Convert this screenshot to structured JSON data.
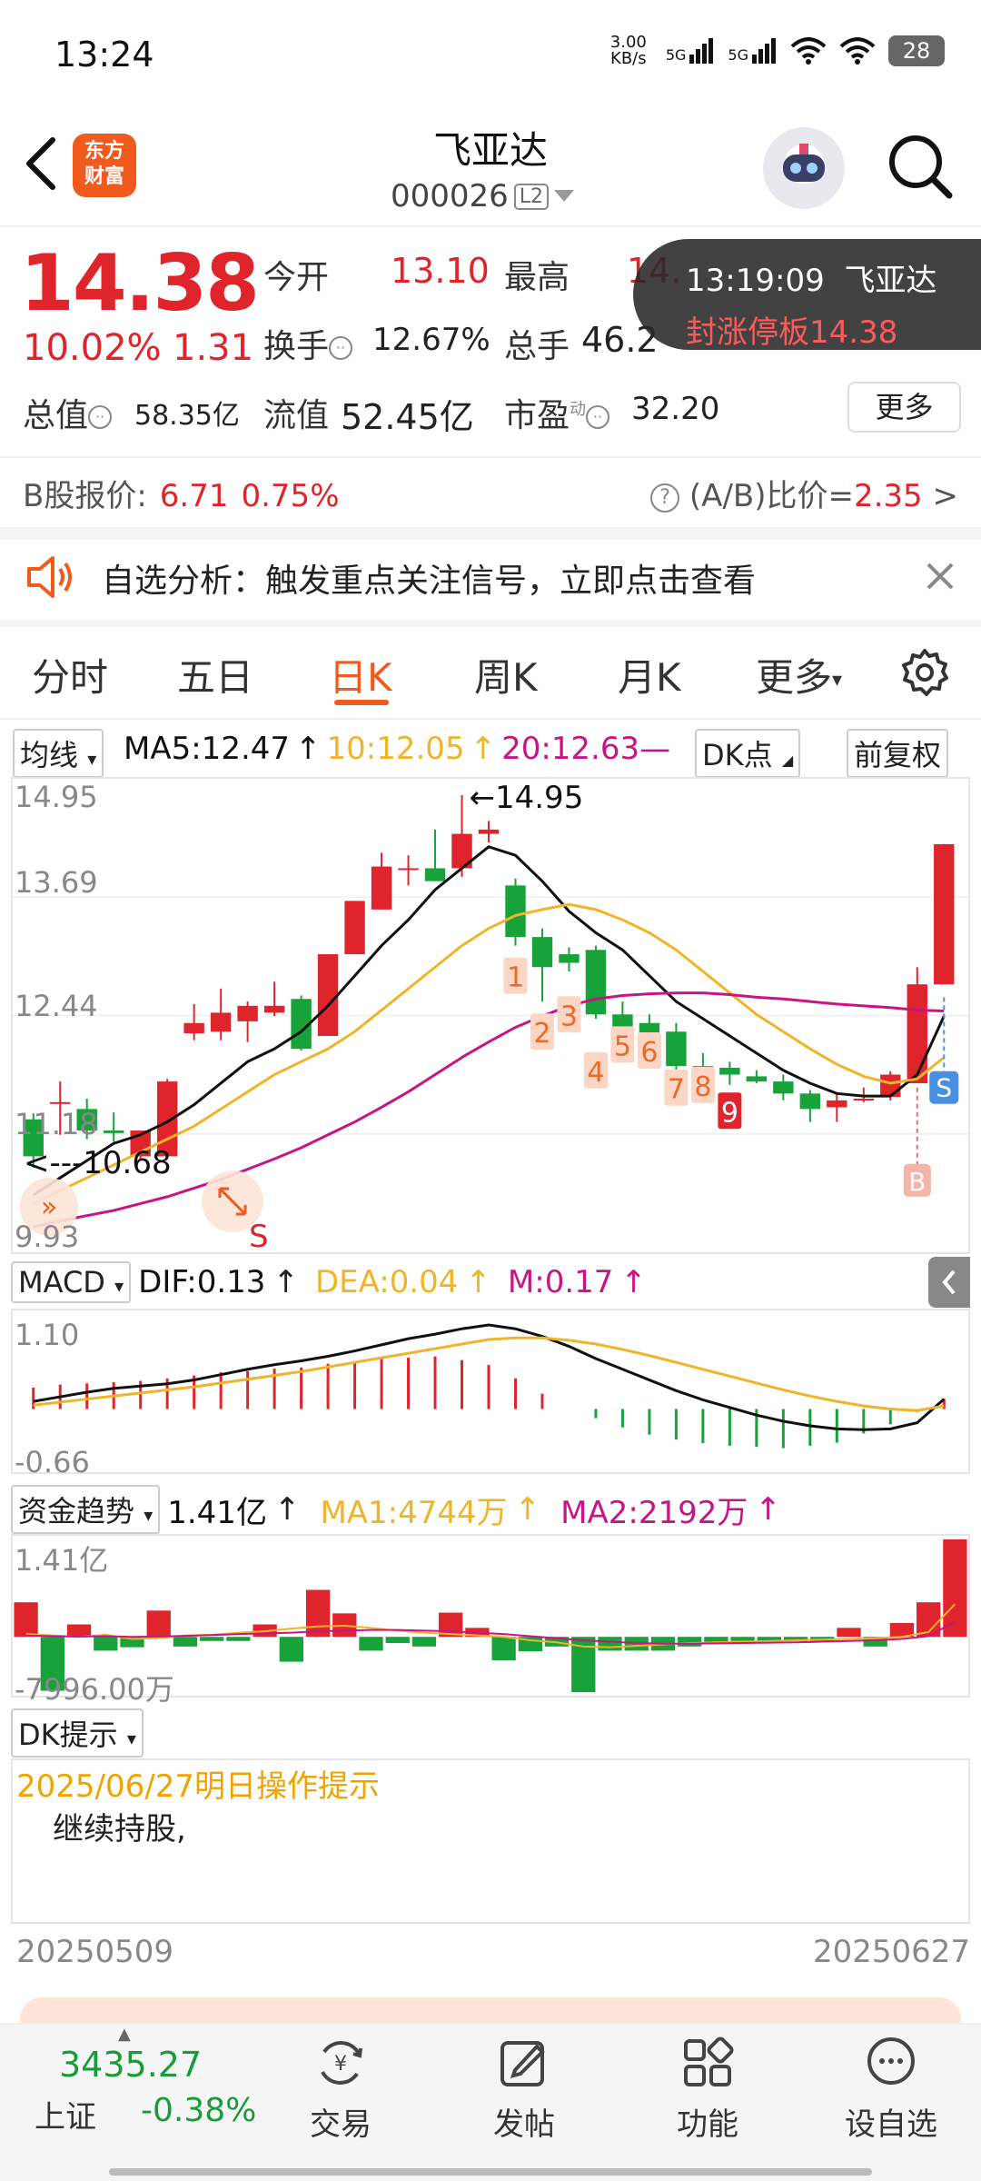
{
  "status_bar": {
    "time": "13:24",
    "net_speed": "3.00 KB/s",
    "signal1": "5G",
    "signal2": "5G",
    "battery": "28"
  },
  "header": {
    "logo_text": "东方财富",
    "stock_name": "飞亚达",
    "stock_code": "000026",
    "level_badge": "L2"
  },
  "quote": {
    "price": "14.38",
    "change_pct": "10.02%",
    "change": "1.31",
    "open_label": "今开",
    "open": "13.10",
    "high_label": "最高",
    "high": "14.",
    "turnover_label": "换手",
    "turnover": "12.67%",
    "volume_label": "总手",
    "volume": "46.2",
    "market_cap_label": "总值",
    "market_cap": "58.35亿",
    "float_cap_label": "流值",
    "float_cap": "52.45亿",
    "pe_label": "市盈",
    "pe_sup": "动",
    "pe": "32.20",
    "more_button": "更多",
    "b_share_label": "B股报价:",
    "b_share_price": "6.71",
    "b_share_pct": "0.75%",
    "ab_ratio_label": "(A/B)比价=",
    "ab_ratio": "2.35"
  },
  "toast": {
    "time": "13:19:09",
    "name": "飞亚达",
    "message": "封涨停板14.38"
  },
  "notice": {
    "text": "自选分析：触发重点关注信号，立即点击查看"
  },
  "tabs": [
    {
      "label": "分时",
      "active": false
    },
    {
      "label": "五日",
      "active": false
    },
    {
      "label": "日K",
      "active": true
    },
    {
      "label": "周K",
      "active": false
    },
    {
      "label": "月K",
      "active": false
    },
    {
      "label": "更多",
      "active": false
    }
  ],
  "kline_header": {
    "indicator_select": "均线",
    "ma5": "MA5:12.47",
    "ma10": "10:12.05",
    "ma20": "20:12.63—",
    "dk_select": "DK点",
    "adjust": "前复权"
  },
  "colors": {
    "up": "#e0242b",
    "down": "#17a23a",
    "ma5": "#111111",
    "ma10": "#f0b429",
    "ma20": "#c71585",
    "accent": "#f05a1c"
  },
  "chart_data": [
    {
      "type": "candlestick",
      "title": "",
      "ylim": [
        9.93,
        14.95
      ],
      "y_ticks": [
        "14.95",
        "13.69",
        "12.44",
        "11.18",
        "9.93"
      ],
      "annotations": {
        "high_marker": "14.95",
        "low_marker": "10.68",
        "sell_mark": "S",
        "buy_mark": "B",
        "signal_mark": "S"
      },
      "seq_labels": [
        "1",
        "2",
        "3",
        "4",
        "5",
        "6",
        "7",
        "8",
        "9"
      ],
      "ohlc": [
        [
          11.18,
          11.25,
          10.62,
          10.75
        ],
        [
          11.38,
          11.62,
          11.0,
          11.38
        ],
        [
          11.3,
          11.42,
          10.95,
          11.05
        ],
        [
          11.05,
          11.26,
          10.92,
          11.02
        ],
        [
          10.75,
          11.05,
          10.7,
          11.05
        ],
        [
          10.75,
          11.65,
          10.75,
          11.62
        ],
        [
          12.18,
          12.52,
          12.1,
          12.3
        ],
        [
          12.2,
          12.7,
          12.1,
          12.42
        ],
        [
          12.32,
          12.55,
          12.08,
          12.5
        ],
        [
          12.42,
          12.78,
          12.38,
          12.5
        ],
        [
          12.58,
          12.62,
          11.98,
          12.0
        ],
        [
          12.15,
          13.1,
          12.15,
          13.1
        ],
        [
          13.1,
          13.72,
          13.1,
          13.72
        ],
        [
          13.62,
          14.28,
          13.62,
          14.12
        ],
        [
          14.1,
          14.25,
          13.9,
          14.1
        ],
        [
          14.1,
          14.55,
          13.95,
          13.95
        ],
        [
          14.1,
          14.95,
          14.0,
          14.5
        ],
        [
          14.5,
          14.65,
          14.4,
          14.55
        ],
        [
          13.9,
          13.98,
          13.2,
          13.3
        ],
        [
          13.3,
          13.4,
          12.55,
          12.95
        ],
        [
          13.1,
          13.18,
          12.9,
          13.0
        ],
        [
          13.15,
          13.2,
          12.35,
          12.4
        ],
        [
          12.4,
          12.55,
          12.15,
          12.22
        ],
        [
          12.3,
          12.4,
          12.0,
          12.18
        ],
        [
          12.2,
          12.3,
          11.72,
          11.8
        ],
        [
          11.8,
          11.95,
          11.72,
          11.78
        ],
        [
          11.78,
          11.85,
          11.58,
          11.7
        ],
        [
          11.68,
          11.75,
          11.6,
          11.62
        ],
        [
          11.62,
          11.7,
          11.4,
          11.48
        ],
        [
          11.48,
          11.52,
          11.15,
          11.3
        ],
        [
          11.32,
          11.48,
          11.15,
          11.4
        ],
        [
          11.4,
          11.55,
          11.38,
          11.42
        ],
        [
          11.44,
          11.74,
          11.4,
          11.7
        ],
        [
          11.6,
          12.95,
          11.6,
          12.75
        ],
        [
          12.75,
          14.38,
          12.75,
          14.38
        ]
      ],
      "series": [
        {
          "name": "MA5",
          "values": [
            10.3,
            10.5,
            10.7,
            10.9,
            11.0,
            11.15,
            11.35,
            11.6,
            11.85,
            12.0,
            12.2,
            12.5,
            12.85,
            13.2,
            13.5,
            13.85,
            14.1,
            14.35,
            14.25,
            13.95,
            13.6,
            13.35,
            13.15,
            12.85,
            12.55,
            12.35,
            12.15,
            11.95,
            11.75,
            11.6,
            11.48,
            11.45,
            11.45,
            11.7,
            12.38
          ]
        },
        {
          "name": "10",
          "values": [
            10.2,
            10.35,
            10.5,
            10.65,
            10.8,
            10.95,
            11.1,
            11.3,
            11.5,
            11.7,
            11.85,
            12.0,
            12.2,
            12.45,
            12.7,
            12.95,
            13.2,
            13.4,
            13.55,
            13.62,
            13.68,
            13.62,
            13.5,
            13.35,
            13.15,
            12.9,
            12.65,
            12.4,
            12.2,
            12.0,
            11.82,
            11.68,
            11.6,
            11.65,
            11.9
          ]
        },
        {
          "name": "20",
          "values": [
            9.93,
            10.0,
            10.06,
            10.12,
            10.2,
            10.28,
            10.38,
            10.48,
            10.6,
            10.72,
            10.85,
            11.0,
            11.15,
            11.32,
            11.5,
            11.7,
            11.9,
            12.08,
            12.25,
            12.38,
            12.5,
            12.58,
            12.62,
            12.64,
            12.65,
            12.65,
            12.63,
            12.6,
            12.58,
            12.55,
            12.52,
            12.5,
            12.48,
            12.45,
            12.44
          ]
        }
      ]
    },
    {
      "type": "bar",
      "title": "MACD",
      "labels": {
        "select": "MACD",
        "dif": "DIF:0.13",
        "dea": "DEA:0.04",
        "m": "M:0.17"
      },
      "y_ticks": [
        "1.10",
        "-0.66"
      ],
      "ylim": [
        -0.66,
        1.1
      ],
      "histogram": [
        0.35,
        0.4,
        0.42,
        0.44,
        0.46,
        0.5,
        0.55,
        0.6,
        0.62,
        0.66,
        0.68,
        0.74,
        0.78,
        0.82,
        0.84,
        0.86,
        0.8,
        0.72,
        0.5,
        0.25,
        0.0,
        -0.15,
        -0.3,
        -0.42,
        -0.5,
        -0.56,
        -0.6,
        -0.62,
        -0.64,
        -0.6,
        -0.55,
        -0.4,
        -0.25,
        -0.05,
        0.17
      ],
      "dif": [
        0.1,
        0.16,
        0.22,
        0.27,
        0.3,
        0.33,
        0.38,
        0.45,
        0.52,
        0.58,
        0.63,
        0.69,
        0.76,
        0.84,
        0.92,
        0.98,
        1.05,
        1.1,
        1.05,
        0.95,
        0.82,
        0.66,
        0.52,
        0.38,
        0.24,
        0.12,
        0.02,
        -0.08,
        -0.16,
        -0.22,
        -0.26,
        -0.27,
        -0.26,
        -0.18,
        0.13
      ],
      "dea": [
        0.05,
        0.09,
        0.13,
        0.17,
        0.21,
        0.25,
        0.29,
        0.34,
        0.39,
        0.44,
        0.49,
        0.55,
        0.61,
        0.67,
        0.73,
        0.79,
        0.85,
        0.91,
        0.93,
        0.93,
        0.9,
        0.85,
        0.78,
        0.7,
        0.61,
        0.52,
        0.43,
        0.34,
        0.25,
        0.17,
        0.1,
        0.04,
        0.0,
        -0.02,
        0.04
      ]
    },
    {
      "type": "bar",
      "title": "资金趋势",
      "labels": {
        "select": "资金趋势",
        "value": "1.41亿",
        "ma1": "MA1:4744万",
        "ma2": "MA2:2192万"
      },
      "y_ticks": [
        "1.41亿",
        "-7996.00万"
      ],
      "ylim": [
        -7996,
        14100
      ],
      "values": [
        5000,
        -7800,
        1800,
        -2000,
        -1500,
        3800,
        -1400,
        -600,
        -600,
        1800,
        -3600,
        6800,
        3400,
        -2000,
        -900,
        -1400,
        3500,
        1300,
        -3400,
        -2100,
        -1400,
        -8000,
        -2000,
        -2000,
        -2000,
        -1400,
        -900,
        -600,
        -600,
        -600,
        -700,
        1300,
        -1400,
        2000,
        5000,
        14100
      ],
      "ma1": [
        400,
        200,
        0,
        300,
        -300,
        -200,
        200,
        300,
        600,
        800,
        1200,
        1500,
        1600,
        1300,
        900,
        600,
        400,
        200,
        0,
        -500,
        -800,
        -1400,
        -1500,
        -1300,
        -1100,
        -900,
        -800,
        -700,
        -600,
        -500,
        -400,
        -300,
        -200,
        0,
        700,
        4744
      ],
      "ma2": [
        200,
        100,
        50,
        100,
        0,
        50,
        150,
        250,
        400,
        500,
        600,
        800,
        900,
        1000,
        1000,
        900,
        800,
        600,
        400,
        100,
        -200,
        -500,
        -700,
        -900,
        -1000,
        -1000,
        -950,
        -900,
        -850,
        -800,
        -700,
        -600,
        -500,
        -300,
        100,
        2192
      ]
    }
  ],
  "dk": {
    "select": "DK提示",
    "title": "2025/06/27明日操作提示",
    "body": "继续持股,"
  },
  "date_range": {
    "start": "20250509",
    "end": "20250627"
  },
  "bottom_nav": {
    "index_value": "3435.27",
    "index_name": "上证",
    "index_pct": "-0.38%",
    "items": [
      {
        "label": "交易",
        "icon": "trade-icon"
      },
      {
        "label": "发帖",
        "icon": "post-icon"
      },
      {
        "label": "功能",
        "icon": "grid-icon"
      },
      {
        "label": "设自选",
        "icon": "chat-icon"
      }
    ]
  }
}
